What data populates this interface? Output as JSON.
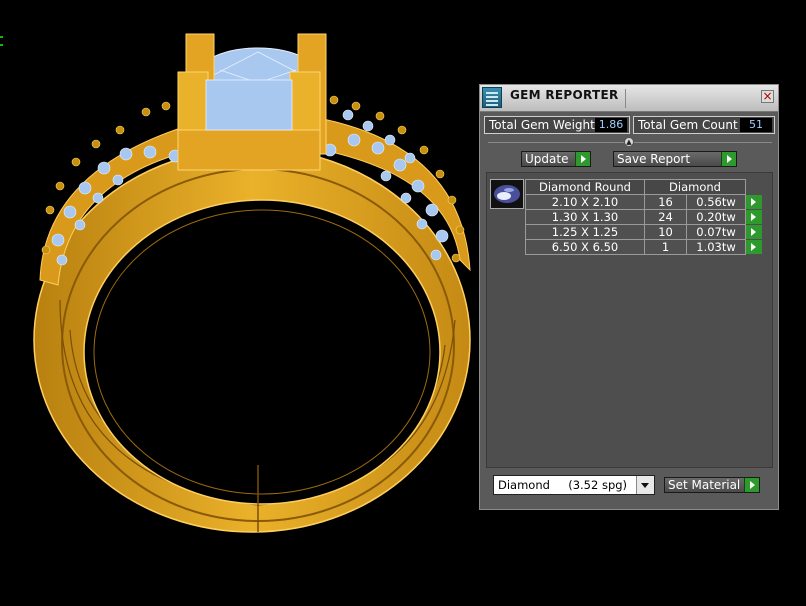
{
  "panel": {
    "title": "GEM REPORTER",
    "close_label": "×",
    "total_gem_weight_label": "Total Gem Weight",
    "total_gem_weight_value": "1.86",
    "total_gem_count_label": "Total Gem Count",
    "total_gem_count_value": "51",
    "update_label": "Update",
    "save_report_label": "Save Report",
    "table": {
      "headers": [
        "Diamond Round",
        "Diamond"
      ],
      "rows": [
        {
          "size": "2.10 X 2.10",
          "count": "16",
          "weight": "0.56tw"
        },
        {
          "size": "1.30 X 1.30",
          "count": "24",
          "weight": "0.20tw"
        },
        {
          "size": "1.25 X 1.25",
          "count": "10",
          "weight": "0.07tw"
        },
        {
          "size": "6.50 X 6.50",
          "count": "1",
          "weight": "1.03tw"
        }
      ]
    },
    "material_value": "Diamond     (3.52 spg)",
    "set_material_label": "Set Material"
  },
  "colors": {
    "ring_gold": "#e8a825",
    "ring_gold_dark": "#b87a10",
    "gem_blue": "#a9c8f0",
    "accent_green": "#2e9a2e",
    "background": "#000000"
  },
  "icons": {
    "app": "gem-reporter-icon",
    "close": "close-icon",
    "thumbnail": "diamond-thumbnail-icon"
  }
}
